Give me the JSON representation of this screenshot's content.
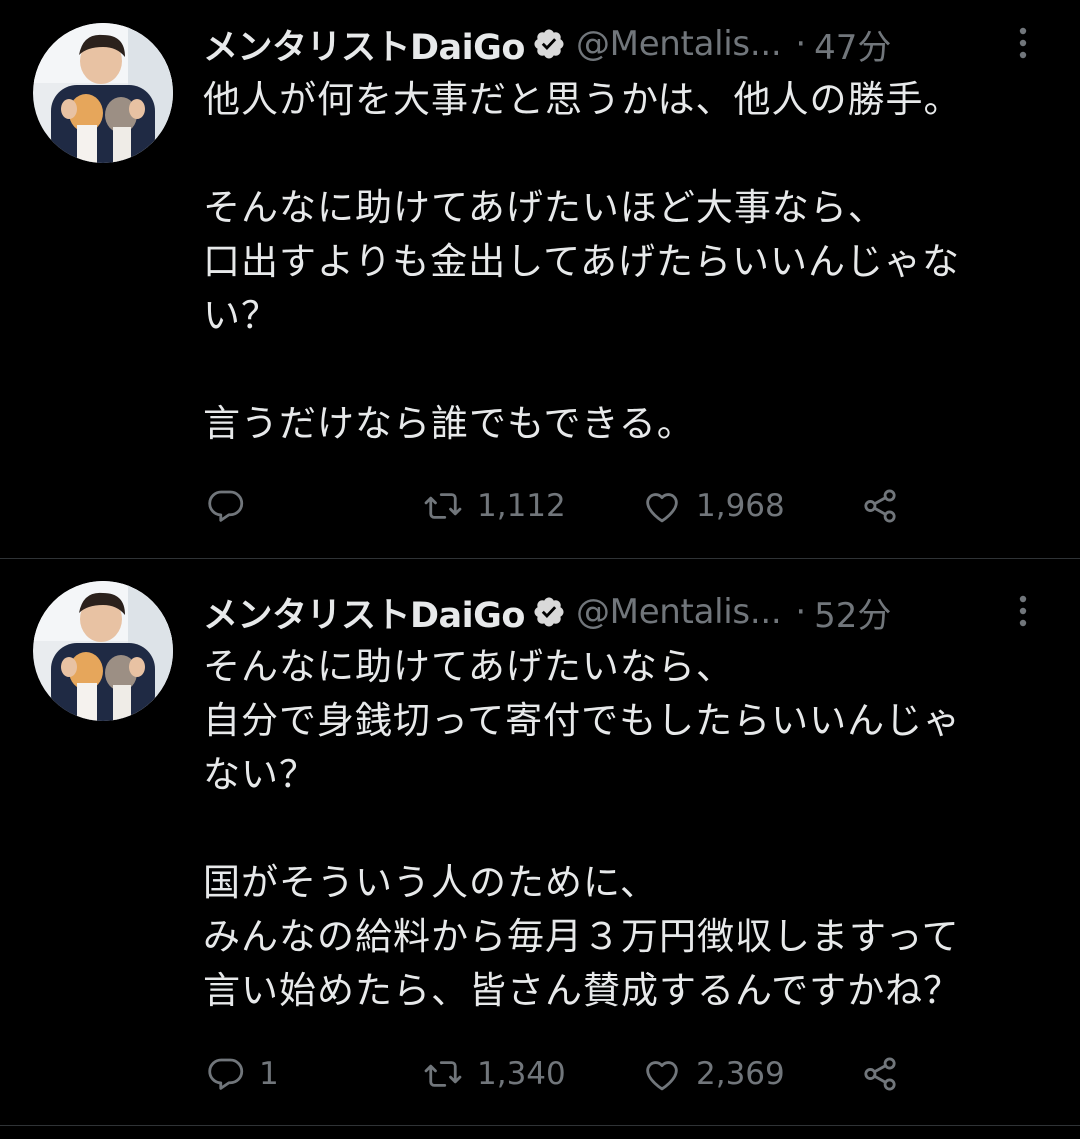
{
  "colors": {
    "background": "#000000",
    "text_primary": "#e7e9ea",
    "text_secondary": "#71767b",
    "divider": "#2f3336"
  },
  "tweets": [
    {
      "display_name": "メンタリストDaiGo",
      "handle": "@Mentalis...",
      "separator": "·",
      "time": "47分",
      "text": "他人が何を大事だと思うかは、他人の勝手。\n\nそんなに助けてあげたいほど大事なら、\n口出すよりも金出してあげたらいいんじゃな\nい？\n\n言うだけなら誰でもできる。",
      "replies": "",
      "retweets": "1,112",
      "likes": "1,968",
      "icons": [
        "verified-badge-icon",
        "more-icon",
        "reply-icon",
        "retweet-icon",
        "like-icon",
        "share-icon"
      ]
    },
    {
      "display_name": "メンタリストDaiGo",
      "handle": "@Mentalis...",
      "separator": "·",
      "time": "52分",
      "text": "そんなに助けてあげたいなら、\n自分で身銭切って寄付でもしたらいいんじゃ\nない？\n\n国がそういう人のために、\nみんなの給料から毎月３万円徴収しますって\n言い始めたら、皆さん賛成するんですかね？",
      "replies": "1",
      "retweets": "1,340",
      "likes": "2,369",
      "icons": [
        "verified-badge-icon",
        "more-icon",
        "reply-icon",
        "retweet-icon",
        "like-icon",
        "share-icon"
      ]
    }
  ]
}
